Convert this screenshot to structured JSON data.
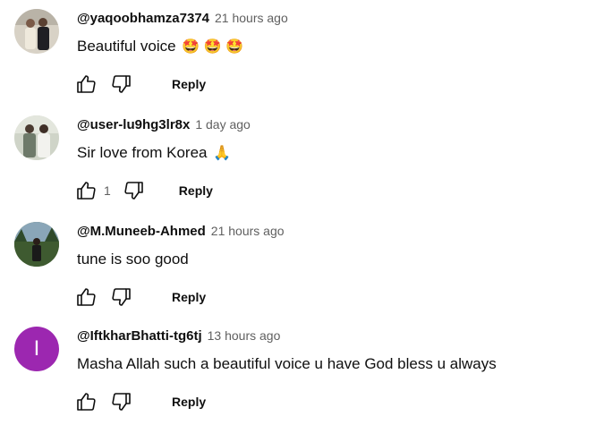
{
  "comments": [
    {
      "author": "@yaqoobhamza7374",
      "time": "21 hours ago",
      "text": "Beautiful voice",
      "emojis": "🤩 🤩 🤩",
      "like_count": "",
      "reply_label": "Reply",
      "avatar": "photo",
      "avatar_letter": ""
    },
    {
      "author": "@user-lu9hg3lr8x",
      "time": "1 day ago",
      "text": "Sir love from Korea",
      "emojis": "🙏",
      "like_count": "1",
      "reply_label": "Reply",
      "avatar": "photo",
      "avatar_letter": ""
    },
    {
      "author": "@M.Muneeb-Ahmed",
      "time": "21 hours ago",
      "text": "tune is soo good",
      "emojis": "",
      "like_count": "",
      "reply_label": "Reply",
      "avatar": "photo",
      "avatar_letter": ""
    },
    {
      "author": "@IftkharBhatti-tg6tj",
      "time": "13 hours ago",
      "text": "Masha Allah such a beautiful voice u have God bless u always",
      "emojis": "",
      "like_count": "",
      "reply_label": "Reply",
      "avatar": "letter",
      "avatar_letter": "I"
    }
  ],
  "colors": {
    "letter_avatar_bg": "#9c27b0",
    "secondary_text": "#606060",
    "primary_text": "#0f0f0f"
  },
  "icons": [
    "like-icon",
    "dislike-icon"
  ]
}
